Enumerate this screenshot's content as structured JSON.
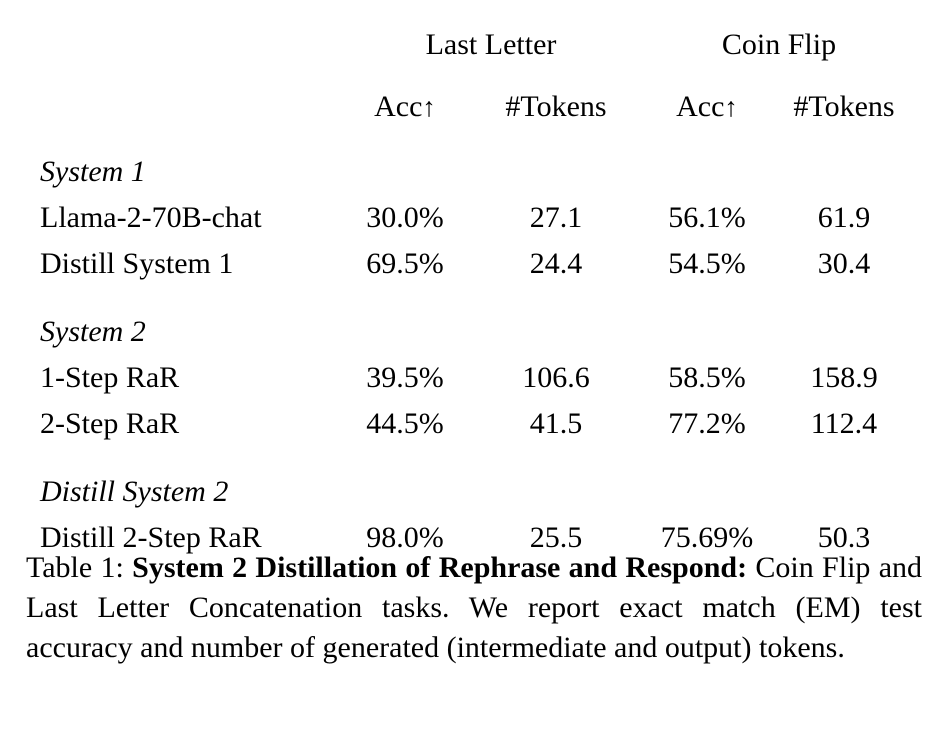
{
  "table": {
    "group_headers": [
      {
        "label": "",
        "span": 1
      },
      {
        "label": "Last Letter",
        "span": 2
      },
      {
        "label": "Coin Flip",
        "span": 2
      }
    ],
    "group_header_last_letter": "Last Letter",
    "group_header_coin_flip": "Coin Flip",
    "column_headers": {
      "label": "",
      "last_letter_acc": "Acc",
      "last_letter_acc_arrow": "↑",
      "last_letter_tokens": "#Tokens",
      "coin_flip_acc": "Acc",
      "coin_flip_acc_arrow": "↑",
      "coin_flip_tokens": "#Tokens"
    },
    "sections": [
      {
        "name": "System 1",
        "rows": [
          {
            "label": "Llama-2-70B-chat",
            "last_letter_acc": "30.0%",
            "last_letter_tokens": "27.1",
            "coin_flip_acc": "56.1%",
            "coin_flip_tokens": "61.9"
          },
          {
            "label": "Distill System 1",
            "last_letter_acc": "69.5%",
            "last_letter_tokens": "24.4",
            "coin_flip_acc": "54.5%",
            "coin_flip_tokens": "30.4"
          }
        ]
      },
      {
        "name": "System 2",
        "rows": [
          {
            "label": "1-Step RaR",
            "last_letter_acc": "39.5%",
            "last_letter_tokens": "106.6",
            "coin_flip_acc": "58.5%",
            "coin_flip_tokens": "158.9"
          },
          {
            "label": "2-Step RaR",
            "last_letter_acc": "44.5%",
            "last_letter_tokens": "41.5",
            "coin_flip_acc": "77.2%",
            "coin_flip_tokens": "112.4"
          }
        ]
      },
      {
        "name": "Distill System 2",
        "rows": [
          {
            "label": "Distill 2-Step RaR",
            "last_letter_acc": "98.0%",
            "last_letter_tokens": "25.5",
            "coin_flip_acc": "75.69%",
            "coin_flip_tokens": "50.3"
          }
        ]
      }
    ]
  },
  "caption": {
    "lead": "Table 1:",
    "title": "System 2 Distillation of Rephrase and Respond",
    "title_suffix": ":",
    "body": "Coin Flip and Last Letter Concatenation tasks.  We report exact match (EM) test accuracy and number of generated (intermediate and output) tokens."
  }
}
